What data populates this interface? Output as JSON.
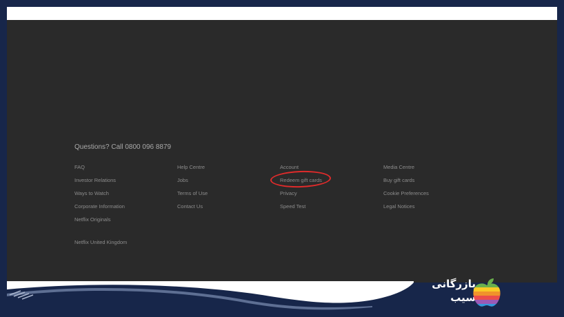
{
  "footer": {
    "questions": "Questions? Call 0800 096 8879",
    "columns": [
      [
        "FAQ",
        "Investor Relations",
        "Ways to Watch",
        "Corporate Information",
        "Netflix Originals"
      ],
      [
        "Help Centre",
        "Jobs",
        "Terms of Use",
        "Contact Us"
      ],
      [
        "Account",
        "Redeem gift cards",
        "Privacy",
        "Speed Test"
      ],
      [
        "Media Centre",
        "Buy gift cards",
        "Cookie Preferences",
        "Legal Notices"
      ]
    ],
    "country": "Netflix United Kingdom",
    "highlighted_link": "Redeem gift cards"
  },
  "brand": {
    "logo_line1": "بازرگانی",
    "logo_line2": "سیب"
  },
  "colors": {
    "frame": "#17264a",
    "screen_bg": "#2a2a2a",
    "link": "#8d8d8d",
    "highlight": "#e02b2b"
  }
}
